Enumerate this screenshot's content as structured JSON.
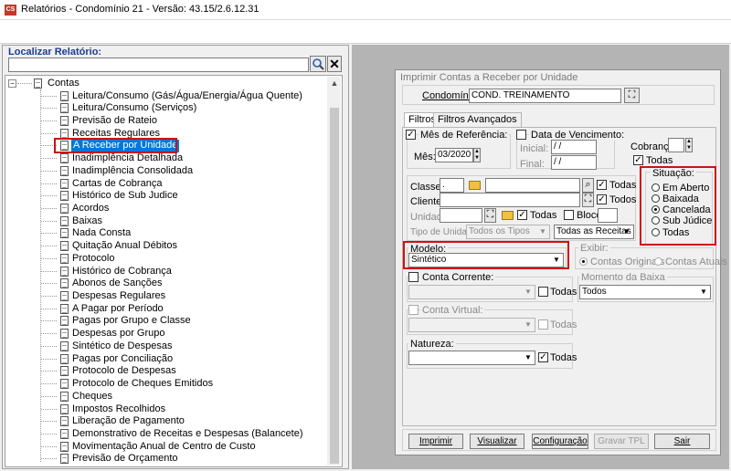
{
  "window": {
    "title": "Relatórios - Condomínio 21 - Versão: 43.15/2.6.12.31",
    "app_icon_text": "CS"
  },
  "search": {
    "label": "Localizar Relatório:",
    "value": "",
    "clear_label": "✕"
  },
  "tree": {
    "root_label": "Contas",
    "selected_index": 5,
    "items": [
      "Leitura/Consumo (Gás/Água/Energia/Água Quente)",
      "Leitura/Consumo (Serviços)",
      "Previsão de Rateio",
      "Receitas Regulares",
      "A Receber por Unidade",
      "Inadimplência Detalhada",
      "Inadimplência Consolidada",
      "Cartas de Cobrança",
      "Histórico de Sub Judice",
      "Acordos",
      "Baixas",
      "Nada Consta",
      "Quitação Anual Débitos",
      "Protocolo",
      "Histórico de Cobrança",
      "Abonos de Sanções",
      "Despesas Regulares",
      "A Pagar por Período",
      "Pagas por Grupo e Classe",
      "Despesas por Grupo",
      "Sintético de Despesas",
      "Pagas por Conciliação",
      "Protocolo de Despesas",
      "Protocolo de Cheques Emitidos",
      "Cheques",
      "Impostos Recolhidos",
      "Liberação de Pagamento",
      "Demonstrativo de Receitas e Despesas (Balancete)",
      "Movimentação Anual de Centro de Custo",
      "Previsão de Orçamento"
    ]
  },
  "dialog": {
    "title": "Imprimir Contas a Receber por Unidade",
    "condominio_label": "Condomínio:",
    "condominio_value": "COND. TREINAMENTO",
    "tabs": [
      "Filtros",
      "Filtros Avançados"
    ],
    "mes_ref_label": "Mês de Referência:",
    "mes_label": "Mês:",
    "mes_value": "03/2020",
    "data_venc_label": "Data de Vencimento:",
    "inicial_label": "Inicial:",
    "final_label": "Final:",
    "date_placeholder": "/ /",
    "cobranca_label": "Cobrança:",
    "cobranca_value": "",
    "todas_label": "Todas",
    "situacao_label": "Situação:",
    "situacao_options": [
      "Em Aberto",
      "Baixada",
      "Cancelada",
      "Sub Júdice",
      "Todas"
    ],
    "situacao_selected": "Cancelada",
    "classe_label": "Classe:",
    "classe_value": ".",
    "cliente_label": "Cliente:",
    "unidade_label": "Unidade:",
    "bloco_label": "Bloco",
    "tipo_unidade_label": "Tipo de Unidade:",
    "tipo_unidade_value": "Todos os Tipos",
    "receitas_value": "Todas as Receitas",
    "modelo_label": "Modelo:",
    "modelo_value": "Sintético",
    "exibir_label": "Exibir:",
    "exibir_options": [
      "Contas Originais",
      "Contas Atuais"
    ],
    "conta_corrente_label": "Conta Corrente:",
    "momento_baixa_label": "Momento da Baixa",
    "momento_baixa_value": "Todos",
    "conta_virtual_label": "Conta Virtual:",
    "natureza_label": "Natureza:",
    "buttons": {
      "imprimir": "Imprimir",
      "visualizar": "Visualizar",
      "configuracao": "Configuração",
      "gravar_tpl": "Gravar TPL",
      "sair": "Sair"
    }
  }
}
